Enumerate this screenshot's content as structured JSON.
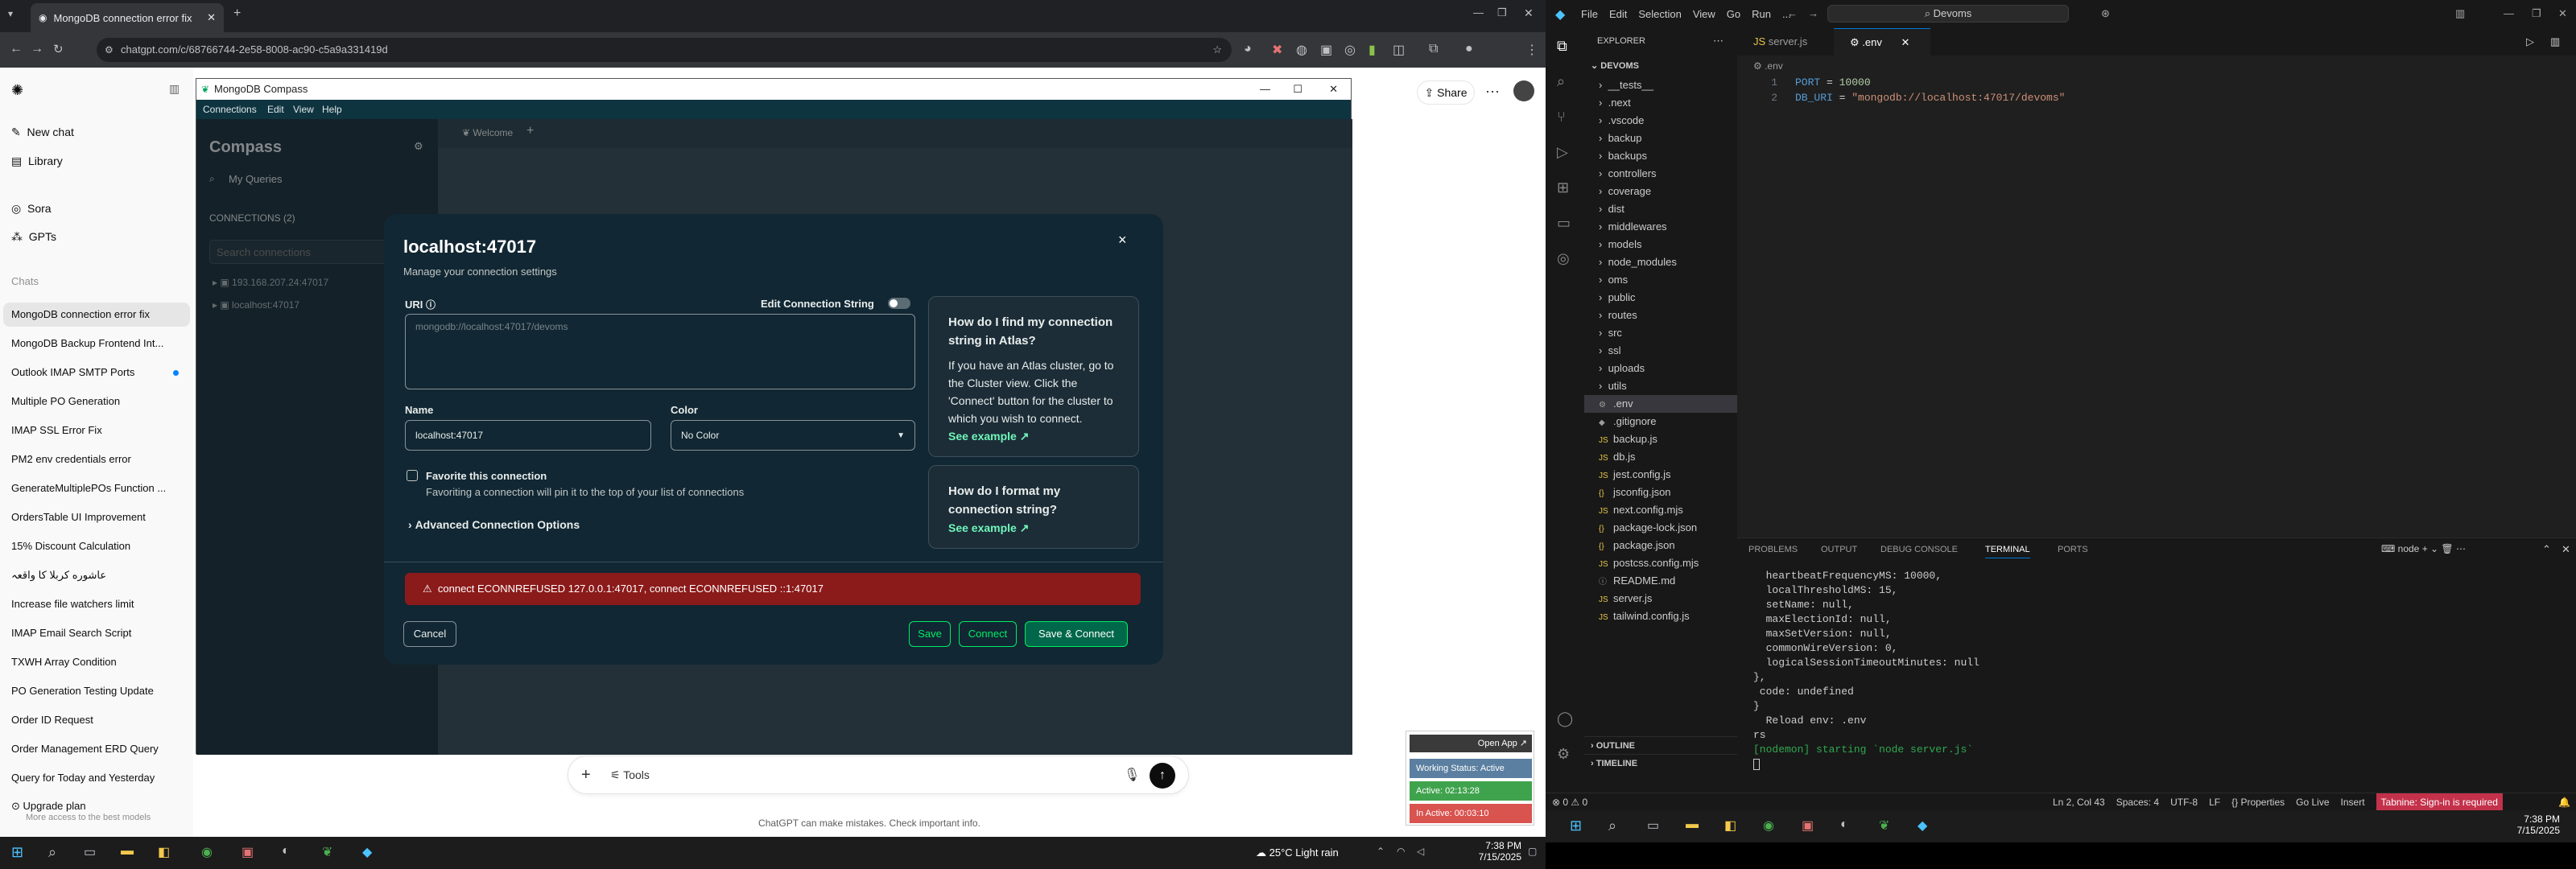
{
  "chrome": {
    "tab_title": "MongoDB connection error fix",
    "url": "chatgpt.com/c/68766744-2e58-8008-ac90-c5a9a331419d",
    "new_tab": "+"
  },
  "chatgpt": {
    "nav": [
      {
        "label": "New chat"
      },
      {
        "label": "Library"
      },
      {
        "label": "Sora"
      },
      {
        "label": "GPTs"
      }
    ],
    "chats_heading": "Chats",
    "chats": [
      "MongoDB connection error fix",
      "MongoDB Backup Frontend Int...",
      "Outlook IMAP SMTP Ports",
      "Multiple PO Generation",
      "IMAP SSL Error Fix",
      "PM2 env credentials error",
      "GenerateMultiplePOs Function ...",
      "OrdersTable UI Improvement",
      "15% Discount Calculation",
      "عاشوره كربلا كا واقعہ",
      "Increase file watchers limit",
      "IMAP Email Search Script",
      "TXWH Array Condition",
      "PO Generation Testing Update",
      "Order ID Request",
      "Order Management ERD Query",
      "Query for Today and Yesterday"
    ],
    "upgrade_title": "Upgrade plan",
    "upgrade_sub": "More access to the best models",
    "share": "Share",
    "tools": "Tools",
    "disclaimer": "ChatGPT can make mistakes. Check important info."
  },
  "compass": {
    "window_title": "MongoDB Compass",
    "menu": [
      "Connections",
      "Edit",
      "View",
      "Help"
    ],
    "brand": "Compass",
    "my_queries": "My Queries",
    "connections_heading": "CONNECTIONS (2)",
    "search_placeholder": "Search connections",
    "connections": [
      "193.168.207.24:47017",
      "localhost:47017"
    ],
    "tab_welcome": "Welcome"
  },
  "modal": {
    "title": "localhost:47017",
    "subtitle": "Manage your connection settings",
    "uri_label": "URI",
    "edit_conn_string": "Edit Connection String",
    "uri_value": "mongodb://localhost:47017/devoms",
    "name_label": "Name",
    "name_value": "localhost:47017",
    "color_label": "Color",
    "color_value": "No Color",
    "favorite_label": "Favorite this connection",
    "favorite_desc": "Favoriting a connection will pin it to the top of your list of connections",
    "advanced": "Advanced Connection Options",
    "help1_title": "How do I find my connection string in Atlas?",
    "help1_body": "If you have an Atlas cluster, go to the Cluster view. Click the 'Connect' button for the cluster to which you wish to connect.",
    "help1_link": "See example",
    "help2_title": "How do I format my connection string?",
    "help2_link": "See example",
    "error": "connect ECONNREFUSED 127.0.0.1:47017, connect ECONNREFUSED ::1:47017",
    "cancel": "Cancel",
    "save": "Save",
    "connect": "Connect",
    "save_connect": "Save & Connect"
  },
  "timer_widget": {
    "open_app": "Open App",
    "working_status": "Working Status: Active",
    "active": "Active: 02:13:28",
    "inactive": "In Active: 00:03:10"
  },
  "left_taskbar": {
    "weather": "25°C  Light rain",
    "time": "7:38 PM",
    "date": "7/15/2025"
  },
  "vscode": {
    "menu": [
      "File",
      "Edit",
      "Selection",
      "View",
      "Go",
      "Run",
      "..."
    ],
    "search": "Devoms",
    "explorer_label": "EXPLORER",
    "project": "DEVOMS",
    "tabs": [
      {
        "label": "server.js",
        "active": false
      },
      {
        "label": ".env",
        "active": true
      }
    ],
    "breadcrumb": ".env",
    "code_lines": [
      {
        "num": "1",
        "key": "PORT",
        "op": " = ",
        "val": "10000",
        "kind": "num"
      },
      {
        "num": "2",
        "key": "DB_URI",
        "op": " = ",
        "val": "\"mongodb://localhost:47017/devoms\"",
        "kind": "str"
      }
    ],
    "folders": [
      "__tests__",
      ".next",
      ".vscode",
      "backup",
      "backups",
      "controllers",
      "coverage",
      "dist",
      "middlewares",
      "models",
      "node_modules",
      "oms",
      "public",
      "routes",
      "src",
      "ssl",
      "uploads",
      "utils"
    ],
    "files": [
      ".env",
      ".gitignore",
      "backup.js",
      "db.js",
      "jest.config.js",
      "jsconfig.json",
      "next.config.mjs",
      "package-lock.json",
      "package.json",
      "postcss.config.mjs",
      "README.md",
      "server.js",
      "tailwind.config.js"
    ],
    "outline": "OUTLINE",
    "timeline": "TIMELINE",
    "panel_tabs": [
      "PROBLEMS",
      "OUTPUT",
      "DEBUG CONSOLE",
      "TERMINAL",
      "PORTS"
    ],
    "terminal_shell": "node",
    "terminal_lines": [
      "  heartbeatFrequencyMS: 10000,",
      "  localThresholdMS: 15,",
      "  setName: null,",
      "  maxElectionId: null,",
      "  maxSetVersion: null,",
      "  commonWireVersion: 0,",
      "  logicalSessionTimeoutMinutes: null",
      "},",
      " code: undefined",
      "}",
      "  Reload env: .env",
      "rs",
      "[nodemon] starting `node server.js`"
    ],
    "status_left": "⊗ 0 ⚠ 0",
    "status_items": [
      "Ln 2, Col 43",
      "Spaces: 4",
      "UTF-8",
      "LF",
      "{} Properties",
      "Go Live",
      "Insert",
      "Tabnine: Sign-in is required"
    ],
    "clock_time": "7:38 PM",
    "clock_date": "7/15/2025"
  },
  "colors": {
    "compass_bg": "#0b2b35",
    "modal_bg": "#112733",
    "error_bg": "#8b1a1a",
    "accent_green": "#00ed64",
    "link_green": "#71f6ba",
    "vscode_blue": "#0078d4"
  }
}
